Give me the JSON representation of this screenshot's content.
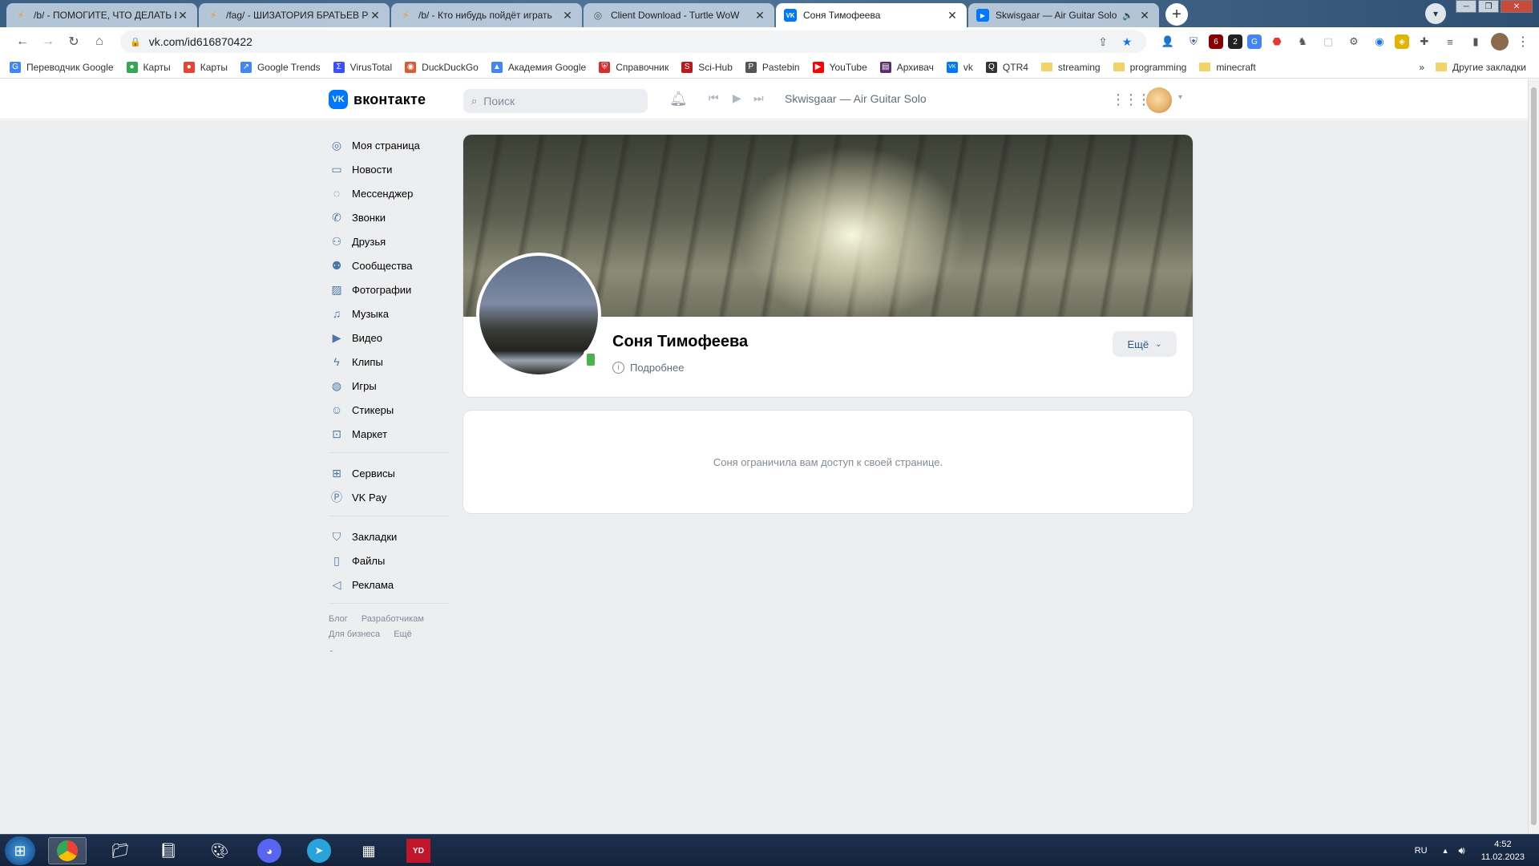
{
  "browser": {
    "tabs": [
      {
        "title": "/b/ - ПОМОГИТЕ, ЧТО ДЕЛАТЬ Е",
        "icon": "lightning-icon",
        "active": false
      },
      {
        "title": "/fag/ - ШИЗАТОРИЯ БРАТЬЕВ РС",
        "icon": "lightning-icon",
        "active": false
      },
      {
        "title": "/b/ - Кто нибудь пойдёт играть",
        "icon": "lightning-icon",
        "active": false
      },
      {
        "title": "Client Download - Turtle WoW",
        "icon": "globe-icon",
        "active": false
      },
      {
        "title": "Соня Тимофеева",
        "icon": "vk-icon",
        "active": true
      },
      {
        "title": "Skwisgaar — Air Guitar Solo",
        "icon": "play-icon",
        "active": false
      }
    ],
    "address": "vk.com/id616870422",
    "bookmarks": [
      {
        "label": "Переводчик Google",
        "icon": "translate-icon",
        "color": "#4285f4"
      },
      {
        "label": "Карты",
        "icon": "map-pin-icon",
        "color": "#34a853"
      },
      {
        "label": "Карты",
        "icon": "map-pin-icon",
        "color": "#ea4335"
      },
      {
        "label": "Google Trends",
        "icon": "trends-icon",
        "color": "#4285f4"
      },
      {
        "label": "VirusTotal",
        "icon": "virustotal-icon",
        "color": "#394eff"
      },
      {
        "label": "DuckDuckGo",
        "icon": "duck-icon",
        "color": "#de5833"
      },
      {
        "label": "Академия Google",
        "icon": "scholar-icon",
        "color": "#4285f4"
      },
      {
        "label": "Справочник",
        "icon": "shield-icon",
        "color": "#d32f2f"
      },
      {
        "label": "Sci-Hub",
        "icon": "scihub-icon",
        "color": "#b71c1c"
      },
      {
        "label": "Pastebin",
        "icon": "pastebin-icon",
        "color": "#555555"
      },
      {
        "label": "YouTube",
        "icon": "youtube-icon",
        "color": "#ff0000"
      },
      {
        "label": "Архивач",
        "icon": "archive-icon",
        "color": "#5b2c6f"
      },
      {
        "label": "vk",
        "icon": "vk-icon",
        "color": "#0077ff"
      },
      {
        "label": "QTR4",
        "icon": "qtr-icon",
        "color": "#333333"
      }
    ],
    "folders": [
      "streaming",
      "programming",
      "minecraft"
    ],
    "other_bookmarks": "Другие закладки"
  },
  "vk": {
    "logo": "вконтакте",
    "logo_mark": "VK",
    "search_placeholder": "Поиск",
    "now_playing": "Skwisgaar — Air Guitar Solo",
    "menu": [
      {
        "label": "Моя страница",
        "icon": "user-circle-icon"
      },
      {
        "label": "Новости",
        "icon": "news-icon"
      },
      {
        "label": "Мессенджер",
        "icon": "chat-icon"
      },
      {
        "label": "Звонки",
        "icon": "phone-icon"
      },
      {
        "label": "Друзья",
        "icon": "friends-icon"
      },
      {
        "label": "Сообщества",
        "icon": "communities-icon"
      },
      {
        "label": "Фотографии",
        "icon": "photo-icon"
      },
      {
        "label": "Музыка",
        "icon": "music-icon"
      },
      {
        "label": "Видео",
        "icon": "video-icon"
      },
      {
        "label": "Клипы",
        "icon": "clips-icon"
      },
      {
        "label": "Игры",
        "icon": "gamepad-icon"
      },
      {
        "label": "Стикеры",
        "icon": "sticker-icon"
      },
      {
        "label": "Маркет",
        "icon": "market-icon"
      }
    ],
    "menu2": [
      {
        "label": "Сервисы",
        "icon": "services-icon"
      },
      {
        "label": "VK Pay",
        "icon": "vkpay-icon"
      }
    ],
    "menu3": [
      {
        "label": "Закладки",
        "icon": "bookmark-icon"
      },
      {
        "label": "Файлы",
        "icon": "file-icon"
      },
      {
        "label": "Реклама",
        "icon": "megaphone-icon"
      }
    ],
    "footer": [
      "Блог",
      "Разработчикам",
      "Для бизнеса",
      "Ещё"
    ],
    "profile": {
      "name": "Соня Тимофеева",
      "details": "Подробнее",
      "more_button": "Ещё",
      "restricted": "Соня ограничила вам доступ к своей странице."
    }
  },
  "taskbar": {
    "language": "RU",
    "time": "4:52",
    "date": "11.02.2023"
  }
}
